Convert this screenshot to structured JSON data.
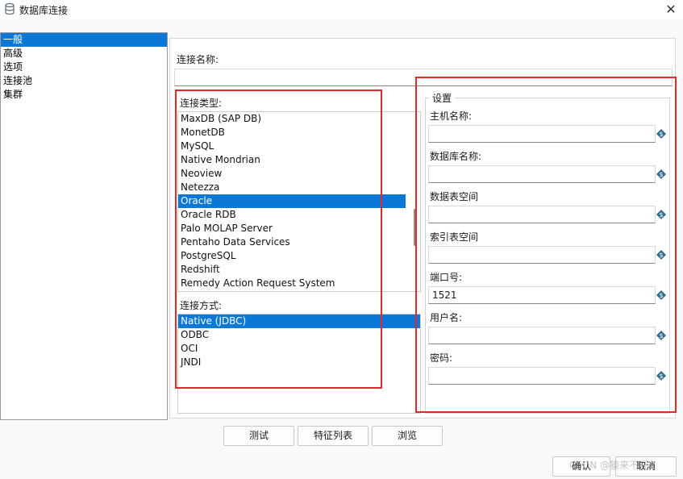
{
  "window": {
    "title": "数据库连接",
    "close_glyph": "✕"
  },
  "nav": {
    "items": [
      {
        "label": "一般",
        "selected": true
      },
      {
        "label": "高级"
      },
      {
        "label": "选项"
      },
      {
        "label": "连接池"
      },
      {
        "label": "集群"
      }
    ]
  },
  "connection_name": {
    "label": "连接名称:",
    "value": ""
  },
  "connection_type": {
    "label": "连接类型:",
    "items": [
      "MaxDB (SAP DB)",
      "MonetDB",
      "MySQL",
      "Native Mondrian",
      "Neoview",
      "Netezza",
      "Oracle",
      "Oracle RDB",
      "Palo MOLAP Server",
      "Pentaho Data Services",
      "PostgreSQL",
      "Redshift",
      "Remedy Action Request System"
    ],
    "selected": "Oracle"
  },
  "access_method": {
    "label": "连接方式:",
    "items": [
      "Native (JDBC)",
      "ODBC",
      "OCI",
      "JNDI"
    ],
    "selected": "Native (JDBC)"
  },
  "settings": {
    "legend": "设置",
    "fields": [
      {
        "label": "主机名称:",
        "value": ""
      },
      {
        "label": "数据库名称:",
        "value": ""
      },
      {
        "label": "数据表空间",
        "value": ""
      },
      {
        "label": "索引表空间",
        "value": ""
      },
      {
        "label": "端口号:",
        "value": "1521"
      },
      {
        "label": "用户名:",
        "value": ""
      },
      {
        "label": "密码:",
        "value": ""
      }
    ]
  },
  "buttons": {
    "test": "测试",
    "features": "特征列表",
    "browse": "浏览",
    "ok": "确认",
    "cancel": "取消"
  },
  "watermark": "CSDN @猿来不开",
  "colors": {
    "selection": "#0b78d7",
    "annotation": "#e02b2b",
    "variable_icon": "#2f6f8f"
  },
  "icons": {
    "app": "database-icon",
    "variable": "variable-icon"
  }
}
